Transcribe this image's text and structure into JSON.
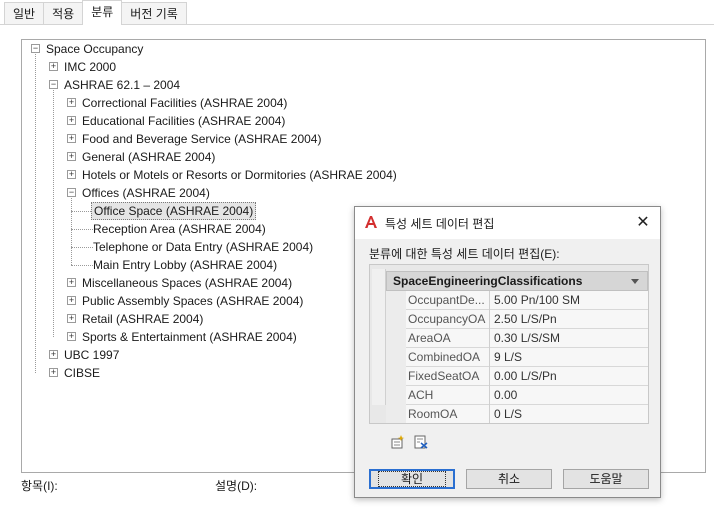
{
  "tabs": [
    "일반",
    "적용",
    "분류",
    "버전 기록"
  ],
  "active_tab": 2,
  "tree": [
    {
      "label": "Space Occupancy",
      "level": 0,
      "toggle": "-",
      "row": 0
    },
    {
      "label": "IMC 2000",
      "level": 1,
      "toggle": "+",
      "row": 1
    },
    {
      "label": "ASHRAE 62.1 – 2004",
      "level": 1,
      "toggle": "-",
      "row": 2
    },
    {
      "label": "Correctional Facilities (ASHRAE 2004)",
      "level": 2,
      "toggle": "+",
      "row": 3
    },
    {
      "label": "Educational Facilities (ASHRAE 2004)",
      "level": 2,
      "toggle": "+",
      "row": 4
    },
    {
      "label": "Food and Beverage Service (ASHRAE 2004)",
      "level": 2,
      "toggle": "+",
      "row": 5
    },
    {
      "label": "General (ASHRAE 2004)",
      "level": 2,
      "toggle": "+",
      "row": 6
    },
    {
      "label": "Hotels or Motels or Resorts or Dormitories (ASHRAE 2004)",
      "level": 2,
      "toggle": "+",
      "row": 7
    },
    {
      "label": "Offices (ASHRAE 2004)",
      "level": 2,
      "toggle": "-",
      "row": 8
    },
    {
      "label": "Office Space (ASHRAE 2004)",
      "level": 3,
      "toggle": "",
      "row": 9,
      "selected": true
    },
    {
      "label": "Reception Area (ASHRAE 2004)",
      "level": 3,
      "toggle": "",
      "row": 10
    },
    {
      "label": "Telephone or Data Entry (ASHRAE 2004)",
      "level": 3,
      "toggle": "",
      "row": 11
    },
    {
      "label": "Main Entry Lobby (ASHRAE 2004)",
      "level": 3,
      "toggle": "",
      "row": 12
    },
    {
      "label": "Miscellaneous Spaces (ASHRAE 2004)",
      "level": 2,
      "toggle": "+",
      "row": 13
    },
    {
      "label": "Public Assembly Spaces (ASHRAE 2004)",
      "level": 2,
      "toggle": "+",
      "row": 14
    },
    {
      "label": "Retail (ASHRAE 2004)",
      "level": 2,
      "toggle": "+",
      "row": 15
    },
    {
      "label": "Sports & Entertainment (ASHRAE 2004)",
      "level": 2,
      "toggle": "+",
      "row": 16
    },
    {
      "label": "UBC 1997",
      "level": 1,
      "toggle": "+",
      "row": 17
    },
    {
      "label": "CIBSE",
      "level": 1,
      "toggle": "+",
      "row": 18
    }
  ],
  "bottom": {
    "item_label": "항목(I):",
    "desc_label": "설명(D):"
  },
  "dialog": {
    "title": "특성 세트 데이터 편집",
    "close": "✕",
    "subtitle": "분류에 대한 특성 세트 데이터 편집(E):",
    "property_set": "SpaceEngineeringClassifications",
    "properties": [
      {
        "name": "OccupantDe...",
        "value": "5.00 Pn/100 SM"
      },
      {
        "name": "OccupancyOA",
        "value": "2.50  L/S/Pn"
      },
      {
        "name": "AreaOA",
        "value": "0.30 L/S/SM"
      },
      {
        "name": "CombinedOA",
        "value": "9 L/S"
      },
      {
        "name": "FixedSeatOA",
        "value": "0.00  L/S/Pn"
      },
      {
        "name": "ACH",
        "value": "0.00"
      },
      {
        "name": "RoomOA",
        "value": "0 L/S"
      }
    ],
    "buttons": {
      "ok": "확인",
      "cancel": "취소",
      "help": "도움말"
    }
  },
  "colors": {
    "accent": "#2a6fd1",
    "app_icon": "#d32f2f"
  }
}
